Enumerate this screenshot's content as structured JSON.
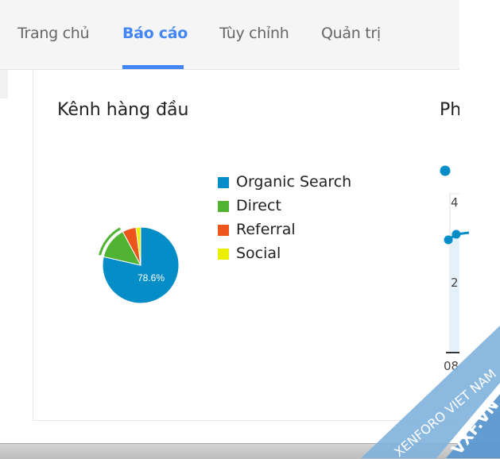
{
  "nav": {
    "tabs": [
      {
        "label": "Trang chủ",
        "active": false
      },
      {
        "label": "Báo cáo",
        "active": true
      },
      {
        "label": "Tùy chỉnh",
        "active": false
      },
      {
        "label": "Quản trị",
        "active": false
      }
    ],
    "accent": "#4285f4"
  },
  "card_channels": {
    "title": "Kênh hàng đầu"
  },
  "card_right": {
    "title_partial": "Ph",
    "ticks": [
      "4",
      "2",
      "08"
    ]
  },
  "chart_data": {
    "type": "pie",
    "title": "Kênh hàng đầu",
    "legend_position": "right",
    "slices": [
      {
        "label": "Organic Search",
        "value": 78.6,
        "color": "#058dc7"
      },
      {
        "label": "Direct",
        "value": 13.6,
        "color": "#50b432"
      },
      {
        "label": "Referral",
        "value": 5.8,
        "color": "#ed561b"
      },
      {
        "label": "Social",
        "value": 2.0,
        "color": "#edef00"
      }
    ],
    "data_labels": [
      "78.6%"
    ],
    "highlighted_slice": "Direct"
  },
  "watermark": {
    "line1": "XENFORO VIET NAM",
    "line2": "VXF.VN"
  }
}
